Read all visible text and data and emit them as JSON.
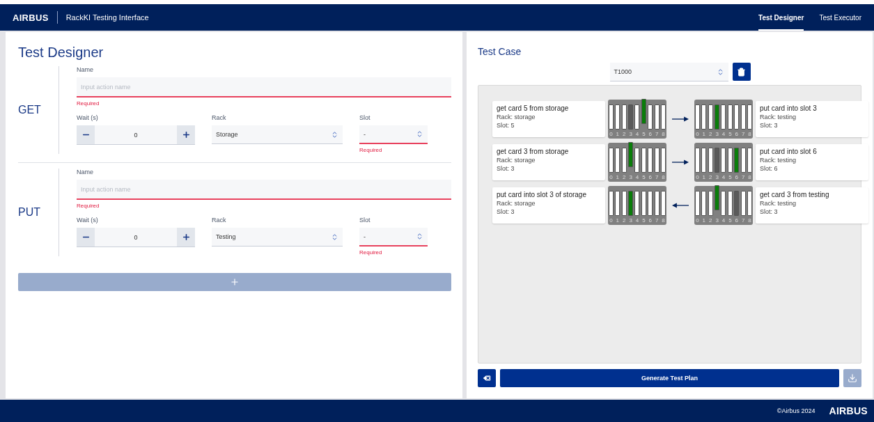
{
  "header": {
    "logo": "AIRBUS",
    "title": "RackKI Testing Interface",
    "tabs": [
      {
        "label": "Test Designer",
        "selected": true
      },
      {
        "label": "Test Executor",
        "selected": false
      }
    ]
  },
  "designer": {
    "title": "Test Designer",
    "actions": [
      {
        "type": "GET",
        "name_label": "Name",
        "name_placeholder": "Input action name",
        "name_error": "Required",
        "wait_label": "Wait (s)",
        "wait_value": "0",
        "rack_label": "Rack",
        "rack_value": "Storage",
        "slot_label": "Slot",
        "slot_value": "-",
        "slot_error": "Required"
      },
      {
        "type": "PUT",
        "name_label": "Name",
        "name_placeholder": "Input action name",
        "name_error": "Required",
        "wait_label": "Wait (s)",
        "wait_value": "0",
        "rack_label": "Rack",
        "rack_value": "Testing",
        "slot_label": "Slot",
        "slot_value": "-",
        "slot_error": "Required"
      }
    ],
    "add_disabled": true
  },
  "test_case": {
    "title": "Test Case",
    "select_value": "T1000",
    "steps": [
      {
        "reversed": false,
        "left": {
          "title": "get card 5 from storage",
          "rack": "Rack: storage",
          "slot": "Slot: 5"
        },
        "right": {
          "title": "put card into slot 3",
          "rack": "Rack: testing",
          "slot": "Slot: 3"
        },
        "left_rack": [
          {
            "label": "0",
            "kind": "card",
            "lifted": false
          },
          {
            "label": "1",
            "kind": "card",
            "lifted": false
          },
          {
            "label": "2",
            "kind": "card",
            "lifted": false
          },
          {
            "label": "3",
            "kind": "empty",
            "lifted": false
          },
          {
            "label": "4",
            "kind": "card",
            "lifted": false
          },
          {
            "label": "5",
            "kind": "moving",
            "lifted": true
          },
          {
            "label": "6",
            "kind": "card",
            "lifted": false
          },
          {
            "label": "7",
            "kind": "card",
            "lifted": false
          },
          {
            "label": "8",
            "kind": "card",
            "lifted": false
          }
        ],
        "right_rack": [
          {
            "label": "0",
            "kind": "card",
            "lifted": false
          },
          {
            "label": "1",
            "kind": "card",
            "lifted": false
          },
          {
            "label": "2",
            "kind": "card",
            "lifted": false
          },
          {
            "label": "3",
            "kind": "moving",
            "lifted": false
          },
          {
            "label": "4",
            "kind": "card",
            "lifted": false
          },
          {
            "label": "5",
            "kind": "card",
            "lifted": false
          },
          {
            "label": "6",
            "kind": "card",
            "lifted": false
          },
          {
            "label": "7",
            "kind": "card",
            "lifted": false
          },
          {
            "label": "8",
            "kind": "card",
            "lifted": false
          }
        ]
      },
      {
        "reversed": false,
        "left": {
          "title": "get card 3 from storage",
          "rack": "Rack: storage",
          "slot": "Slot: 3"
        },
        "right": {
          "title": "put card into slot 6",
          "rack": "Rack: testing",
          "slot": "Slot: 6"
        },
        "left_rack": [
          {
            "label": "0",
            "kind": "card",
            "lifted": false
          },
          {
            "label": "1",
            "kind": "card",
            "lifted": false
          },
          {
            "label": "2",
            "kind": "card",
            "lifted": false
          },
          {
            "label": "3",
            "kind": "moving",
            "lifted": true
          },
          {
            "label": "4",
            "kind": "card",
            "lifted": false
          },
          {
            "label": "5",
            "kind": "card",
            "lifted": false
          },
          {
            "label": "6",
            "kind": "card",
            "lifted": false
          },
          {
            "label": "7",
            "kind": "card",
            "lifted": false
          },
          {
            "label": "8",
            "kind": "card",
            "lifted": false
          }
        ],
        "right_rack": [
          {
            "label": "0",
            "kind": "card",
            "lifted": false
          },
          {
            "label": "1",
            "kind": "card",
            "lifted": false
          },
          {
            "label": "2",
            "kind": "card",
            "lifted": false
          },
          {
            "label": "3",
            "kind": "empty",
            "lifted": false
          },
          {
            "label": "4",
            "kind": "card",
            "lifted": false
          },
          {
            "label": "5",
            "kind": "card",
            "lifted": false
          },
          {
            "label": "6",
            "kind": "moving",
            "lifted": false
          },
          {
            "label": "7",
            "kind": "card",
            "lifted": false
          },
          {
            "label": "8",
            "kind": "card",
            "lifted": false
          }
        ]
      },
      {
        "reversed": true,
        "left": {
          "title": "put card into slot 3 of storage",
          "rack": "Rack: storage",
          "slot": "Slot: 3"
        },
        "right": {
          "title": "get card 3 from testing",
          "rack": "Rack: testing",
          "slot": "Slot: 3"
        },
        "left_rack": [
          {
            "label": "0",
            "kind": "card",
            "lifted": false
          },
          {
            "label": "1",
            "kind": "card",
            "lifted": false
          },
          {
            "label": "2",
            "kind": "card",
            "lifted": false
          },
          {
            "label": "3",
            "kind": "moving",
            "lifted": false
          },
          {
            "label": "4",
            "kind": "card",
            "lifted": false
          },
          {
            "label": "5",
            "kind": "card",
            "lifted": false
          },
          {
            "label": "6",
            "kind": "card",
            "lifted": false
          },
          {
            "label": "7",
            "kind": "card",
            "lifted": false
          },
          {
            "label": "8",
            "kind": "card",
            "lifted": false
          }
        ],
        "right_rack": [
          {
            "label": "0",
            "kind": "card",
            "lifted": false
          },
          {
            "label": "1",
            "kind": "card",
            "lifted": false
          },
          {
            "label": "2",
            "kind": "card",
            "lifted": false
          },
          {
            "label": "3",
            "kind": "moving",
            "lifted": true
          },
          {
            "label": "4",
            "kind": "card",
            "lifted": false
          },
          {
            "label": "5",
            "kind": "card",
            "lifted": false
          },
          {
            "label": "6",
            "kind": "empty",
            "lifted": false
          },
          {
            "label": "7",
            "kind": "card",
            "lifted": false
          },
          {
            "label": "8",
            "kind": "card",
            "lifted": false
          }
        ]
      }
    ],
    "generate_label": "Generate Test Plan",
    "download_disabled": true
  },
  "footer": {
    "copyright": "©Airbus 2024",
    "logo": "AIRBUS"
  }
}
